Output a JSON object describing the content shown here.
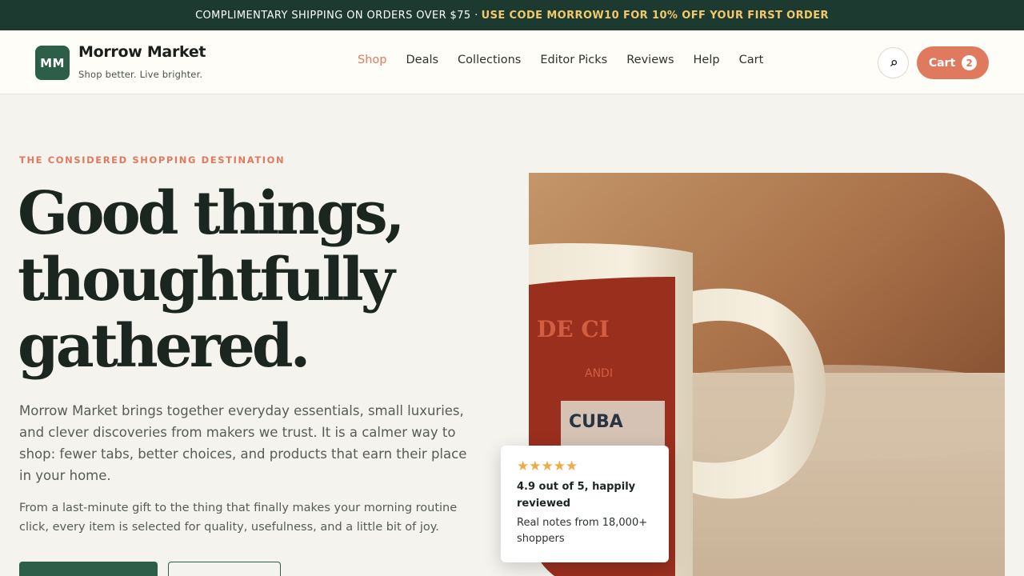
{
  "announcement": {
    "text": "COMPLIMENTARY SHIPPING ON ORDERS OVER $75 ·",
    "code_text": "USE CODE MORROW10 FOR 10% OFF YOUR FIRST ORDER"
  },
  "brand": {
    "initials": "MM",
    "name": "Morrow Market",
    "tagline": "Shop better. Live brighter."
  },
  "nav": {
    "items": [
      "Shop",
      "Deals",
      "Collections",
      "Editor Picks",
      "Reviews",
      "Help",
      "Cart"
    ],
    "active": "Shop"
  },
  "header_actions": {
    "search_icon": "search-icon",
    "cart_label": "Cart",
    "cart_count": "2"
  },
  "hero": {
    "eyebrow": "THE CONSIDERED SHOPPING DESTINATION",
    "headline_line1": "Good things,",
    "headline_line2": "thoughtfully",
    "headline_line3": "gathered.",
    "lead": "Morrow Market brings together everyday essentials, small luxuries, and clever discoveries from makers we trust. It is a calmer way to shop: fewer tabs, better choices, and products that earn their place in your home.",
    "sub": "From a last-minute gift to the thing that finally makes your morning routine click, every item is selected for quality, usefulness, and a little bit of joy."
  },
  "review_card": {
    "stars": "★★★★★",
    "title": "4.9 out of 5, happily reviewed",
    "note": "Real notes from 18,000+ shoppers"
  },
  "colors": {
    "topbar": "#1c3a30",
    "code_highlight": "#f3c969",
    "accent": "#e07a5f",
    "brand_green": "#2d5e4a"
  }
}
